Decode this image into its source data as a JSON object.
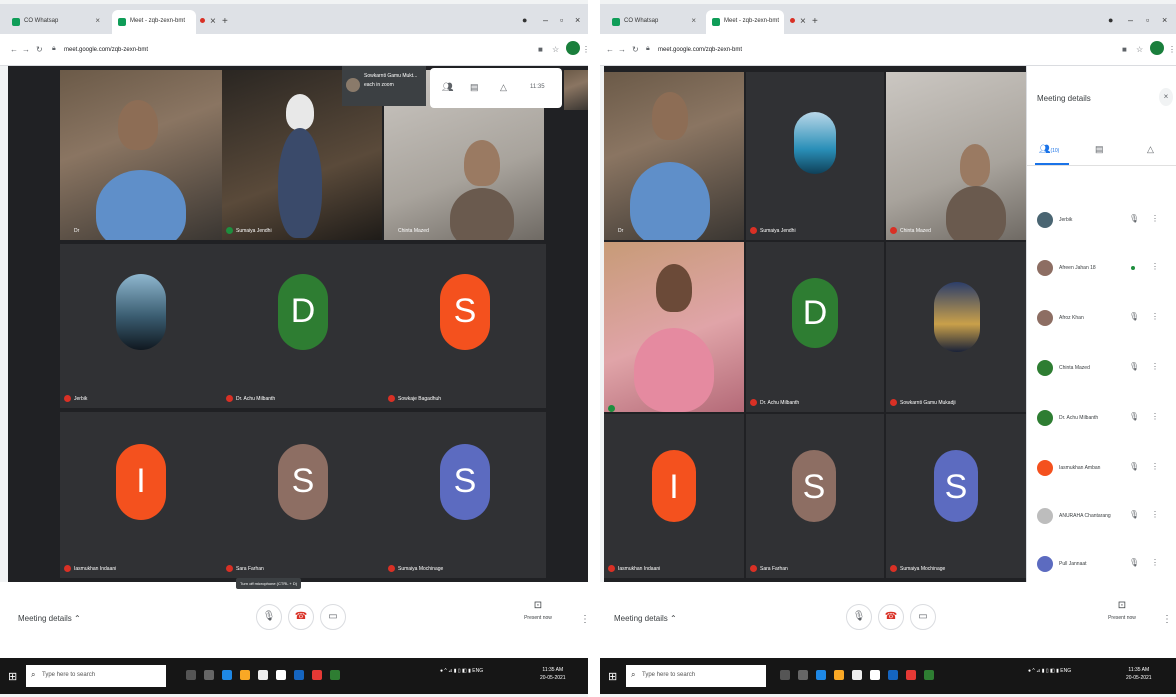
{
  "left": {
    "tabs": [
      {
        "label": "CO Whatsap",
        "active": false
      },
      {
        "label": "Meet - zqb-zexn-bmt",
        "active": true
      }
    ],
    "url": "meet.google.com/zqb-zexn-bmt",
    "presenter_popup": {
      "line1": "Sowkarnti Gamu Mukt...",
      "line2": "each in zoom"
    },
    "time": "11:35",
    "tiles": [
      {
        "name": "Dr",
        "kind": "video"
      },
      {
        "name": "Sumaiya Jendhi",
        "kind": "video"
      },
      {
        "name": "Chinta Mazed",
        "kind": "video"
      },
      {
        "name": "Jerbik",
        "kind": "avatar-photo"
      },
      {
        "name": "Dr. Achu Milbanth",
        "kind": "avatar",
        "letter": "D",
        "color": "#2e7d32"
      },
      {
        "name": "Sowkaje Bagadhuh",
        "kind": "avatar",
        "letter": "S",
        "color": "#f4511e"
      },
      {
        "name": "Iasmukhan Indaani",
        "kind": "avatar",
        "letter": "I",
        "color": "#f4511e"
      },
      {
        "name": "Sara Farhan",
        "kind": "avatar",
        "letter": "S",
        "color": "#8d6e63"
      },
      {
        "name": "Sumaiya Mochinage",
        "kind": "avatar",
        "letter": "S",
        "color": "#5c6bc0"
      }
    ],
    "meeting_details": "Meeting details",
    "tooltip": "Turn off microphone (CTRL + D)",
    "present_now": "Present now",
    "search_placeholder": "Type here to search",
    "clock_time": "11:35 AM",
    "clock_date": "20-05-2021"
  },
  "right": {
    "tabs": [
      {
        "label": "CO Whatsap",
        "active": false
      },
      {
        "label": "Meet - zqb-zexn-bmt",
        "active": true
      }
    ],
    "url": "meet.google.com/zqb-zexn-bmt",
    "tiles": [
      {
        "name": "Dr",
        "kind": "video"
      },
      {
        "name": "Sumaiya Jendhi",
        "kind": "avatar-photo"
      },
      {
        "name": "Chinta Mazed",
        "kind": "video"
      },
      {
        "name": "",
        "kind": "video"
      },
      {
        "name": "Dr. Achu Milbanth",
        "kind": "avatar",
        "letter": "D",
        "color": "#2e7d32"
      },
      {
        "name": "Sowkarnti Gamu Mukadji",
        "kind": "avatar-photo"
      },
      {
        "name": "Iasmukhan Indaani",
        "kind": "avatar",
        "letter": "I",
        "color": "#f4511e"
      },
      {
        "name": "Sara Farhan",
        "kind": "avatar",
        "letter": "S",
        "color": "#8d6e63"
      },
      {
        "name": "Sumaiya Mochinage",
        "kind": "avatar",
        "letter": "S",
        "color": "#5c6bc0"
      }
    ],
    "side_panel": {
      "title": "Meeting details",
      "people_count": "(10)",
      "participants": [
        {
          "name": "Jerbik",
          "color": "#4a6572",
          "speaking": false
        },
        {
          "name": "Afreen Jahan 18",
          "color": "#8d6e63",
          "speaking": true
        },
        {
          "name": "Afroz Khan",
          "color": "#8d6e63",
          "speaking": false
        },
        {
          "name": "Chinta Mazed",
          "color": "#2e7d32",
          "speaking": false
        },
        {
          "name": "Dr. Achu Milbanth",
          "color": "#2e7d32",
          "speaking": false
        },
        {
          "name": "Iasmukhan Amban",
          "color": "#f4511e",
          "speaking": false
        },
        {
          "name": "ANURAHA Chantarang",
          "color": "#bdbdbd",
          "speaking": false
        },
        {
          "name": "Pull Jannaat",
          "color": "#5c6bc0",
          "speaking": false
        }
      ]
    },
    "meeting_details": "Meeting details",
    "present_now": "Present now",
    "search_placeholder": "Type here to search",
    "clock_time": "11:35 AM",
    "clock_date": "20-05-2021"
  }
}
